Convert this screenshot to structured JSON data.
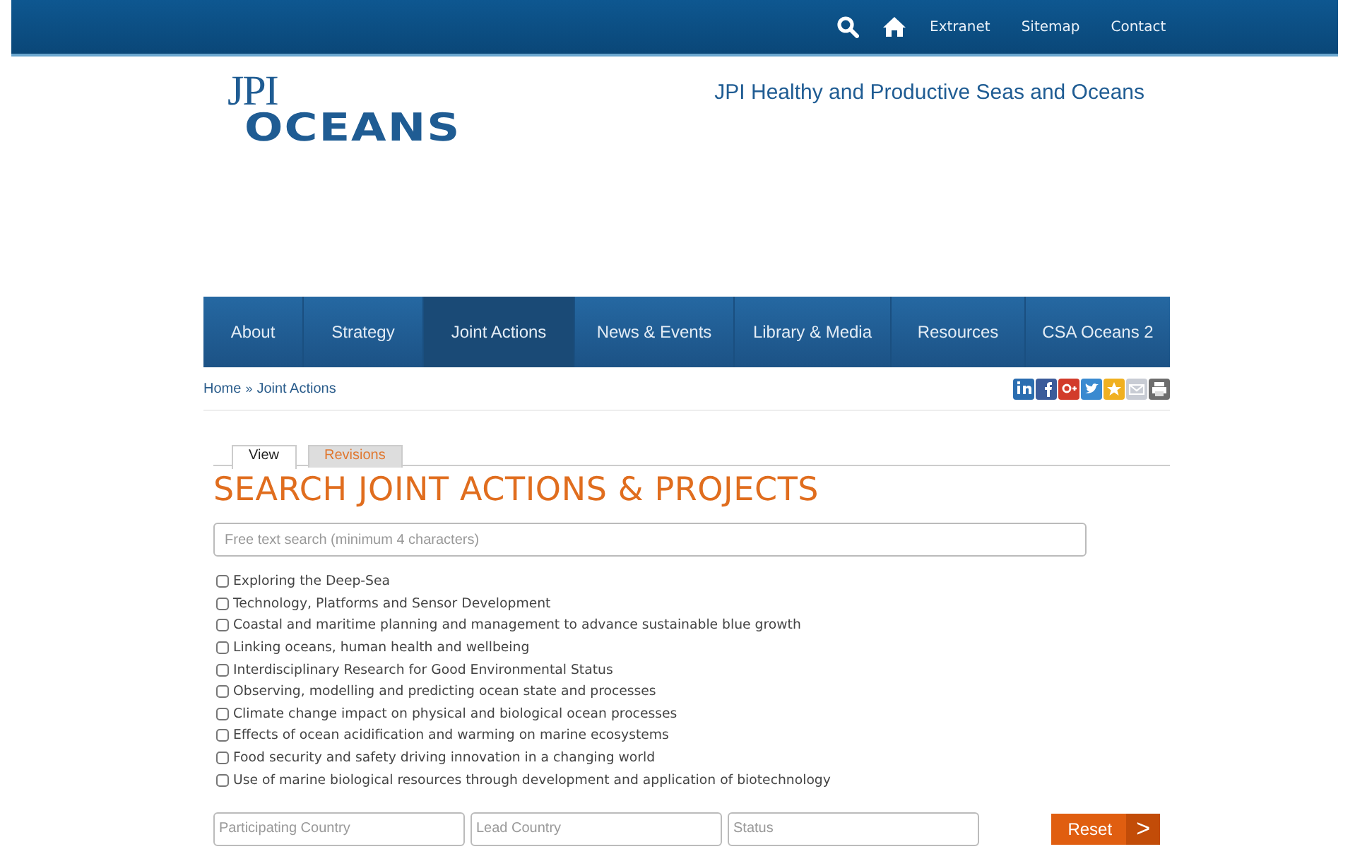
{
  "top_bar": {
    "links": [
      "Extranet",
      "Sitemap",
      "Contact"
    ]
  },
  "logo": {
    "line_1": "JPI",
    "line_2": "OCEANS"
  },
  "tagline": "JPI Healthy and Productive Seas and Oceans",
  "nav": [
    {
      "label": "About",
      "selected": false
    },
    {
      "label": "Strategy",
      "selected": false
    },
    {
      "label": "Joint Actions",
      "selected": true
    },
    {
      "label": "News & Events",
      "selected": false
    },
    {
      "label": "Library & Media",
      "selected": false
    },
    {
      "label": "Resources",
      "selected": false
    },
    {
      "label": "CSA Oceans 2",
      "selected": false
    }
  ],
  "breadcrumb": {
    "items": [
      "Home",
      "Joint Actions"
    ],
    "separator": "»"
  },
  "share_icons": [
    {
      "kind": "linkedin",
      "color": "#2a6db0"
    },
    {
      "kind": "facebook",
      "color": "#3b5b9a"
    },
    {
      "kind": "googleplus",
      "color": "#d23b2b"
    },
    {
      "kind": "twitter",
      "color": "#3a8ad0"
    },
    {
      "kind": "favorite",
      "color": "#f0b020"
    },
    {
      "kind": "email",
      "color": "#c8ccd4"
    },
    {
      "kind": "print",
      "color": "#6d6d6d"
    }
  ],
  "tabs": [
    {
      "label": "View",
      "selected": true
    },
    {
      "label": "Revisions",
      "selected": false
    }
  ],
  "heading": "SEARCH JOINT ACTIONS & PROJECTS",
  "search": {
    "placeholder": "Free text search (minimum 4 characters)"
  },
  "themes": [
    {
      "label": "Exploring the Deep-Sea",
      "checked": false
    },
    {
      "label": "Technology, Platforms and Sensor Development",
      "checked": false
    },
    {
      "label": "Coastal and maritime planning and management to advance sustainable blue growth",
      "checked": false
    },
    {
      "label": "Linking oceans, human health and wellbeing",
      "checked": false
    },
    {
      "label": "Interdisciplinary Research for Good Environmental Status",
      "checked": false
    },
    {
      "label": "Observing, modelling and predicting ocean state and processes",
      "checked": false
    },
    {
      "label": "Climate change impact on physical and biological ocean processes",
      "checked": false
    },
    {
      "label": "Effects of ocean acidification and warming on marine ecosystems",
      "checked": false
    },
    {
      "label": "Food security and safety driving innovation in a changing world",
      "checked": false
    },
    {
      "label": "Use of marine biological resources through development and application of biotechnology",
      "checked": false
    }
  ],
  "filters": [
    {
      "placeholder": "Participating Country"
    },
    {
      "placeholder": "Lead Country"
    },
    {
      "placeholder": "Status"
    }
  ],
  "reset_button": {
    "label": "Reset",
    "arrow": ">"
  }
}
